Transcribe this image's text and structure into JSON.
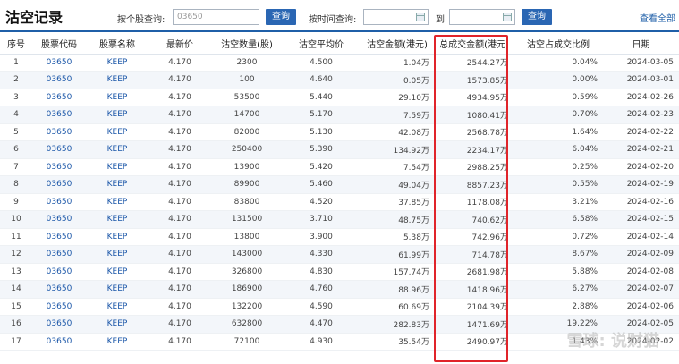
{
  "header": {
    "title": "沽空记录",
    "stock_label": "按个股查询:",
    "stock_value": "03650",
    "query_button": "查询",
    "time_label": "按时间查询:",
    "to_label": "到",
    "query_button2": "查询",
    "view_all": "查看全部"
  },
  "table": {
    "columns": [
      "序号",
      "股票代码",
      "股票名称",
      "最新价",
      "沽空数量(股)",
      "沽空平均价",
      "沽空金额(港元)",
      "总成交金额(港元)",
      "沽空占成交比例",
      "日期"
    ],
    "rows": [
      [
        "1",
        "03650",
        "KEEP",
        "4.170",
        "2300",
        "4.500",
        "1.04万",
        "2544.27万",
        "0.04%",
        "2024-03-05"
      ],
      [
        "2",
        "03650",
        "KEEP",
        "4.170",
        "100",
        "4.640",
        "0.05万",
        "1573.85万",
        "0.00%",
        "2024-03-01"
      ],
      [
        "3",
        "03650",
        "KEEP",
        "4.170",
        "53500",
        "5.440",
        "29.10万",
        "4934.95万",
        "0.59%",
        "2024-02-26"
      ],
      [
        "4",
        "03650",
        "KEEP",
        "4.170",
        "14700",
        "5.170",
        "7.59万",
        "1080.41万",
        "0.70%",
        "2024-02-23"
      ],
      [
        "5",
        "03650",
        "KEEP",
        "4.170",
        "82000",
        "5.130",
        "42.08万",
        "2568.78万",
        "1.64%",
        "2024-02-22"
      ],
      [
        "6",
        "03650",
        "KEEP",
        "4.170",
        "250400",
        "5.390",
        "134.92万",
        "2234.17万",
        "6.04%",
        "2024-02-21"
      ],
      [
        "7",
        "03650",
        "KEEP",
        "4.170",
        "13900",
        "5.420",
        "7.54万",
        "2988.25万",
        "0.25%",
        "2024-02-20"
      ],
      [
        "8",
        "03650",
        "KEEP",
        "4.170",
        "89900",
        "5.460",
        "49.04万",
        "8857.23万",
        "0.55%",
        "2024-02-19"
      ],
      [
        "9",
        "03650",
        "KEEP",
        "4.170",
        "83800",
        "4.520",
        "37.85万",
        "1178.08万",
        "3.21%",
        "2024-02-16"
      ],
      [
        "10",
        "03650",
        "KEEP",
        "4.170",
        "131500",
        "3.710",
        "48.75万",
        "740.62万",
        "6.58%",
        "2024-02-15"
      ],
      [
        "11",
        "03650",
        "KEEP",
        "4.170",
        "13800",
        "3.900",
        "5.38万",
        "742.96万",
        "0.72%",
        "2024-02-14"
      ],
      [
        "12",
        "03650",
        "KEEP",
        "4.170",
        "143000",
        "4.330",
        "61.99万",
        "714.78万",
        "8.67%",
        "2024-02-09"
      ],
      [
        "13",
        "03650",
        "KEEP",
        "4.170",
        "326800",
        "4.830",
        "157.74万",
        "2681.98万",
        "5.88%",
        "2024-02-08"
      ],
      [
        "14",
        "03650",
        "KEEP",
        "4.170",
        "186900",
        "4.760",
        "88.96万",
        "1418.96万",
        "6.27%",
        "2024-02-07"
      ],
      [
        "15",
        "03650",
        "KEEP",
        "4.170",
        "132200",
        "4.590",
        "60.69万",
        "2104.39万",
        "2.88%",
        "2024-02-06"
      ],
      [
        "16",
        "03650",
        "KEEP",
        "4.170",
        "632800",
        "4.470",
        "282.83万",
        "1471.69万",
        "19.22%",
        "2024-02-05"
      ],
      [
        "17",
        "03650",
        "KEEP",
        "4.170",
        "72100",
        "4.930",
        "35.54万",
        "2490.97万",
        "1.43%",
        "2024-02-02"
      ]
    ]
  },
  "watermark": "雪球: 说财猫",
  "colors": {
    "accent": "#1f5fa8",
    "highlight_box": "#e0242a",
    "link": "#1a56a8"
  }
}
